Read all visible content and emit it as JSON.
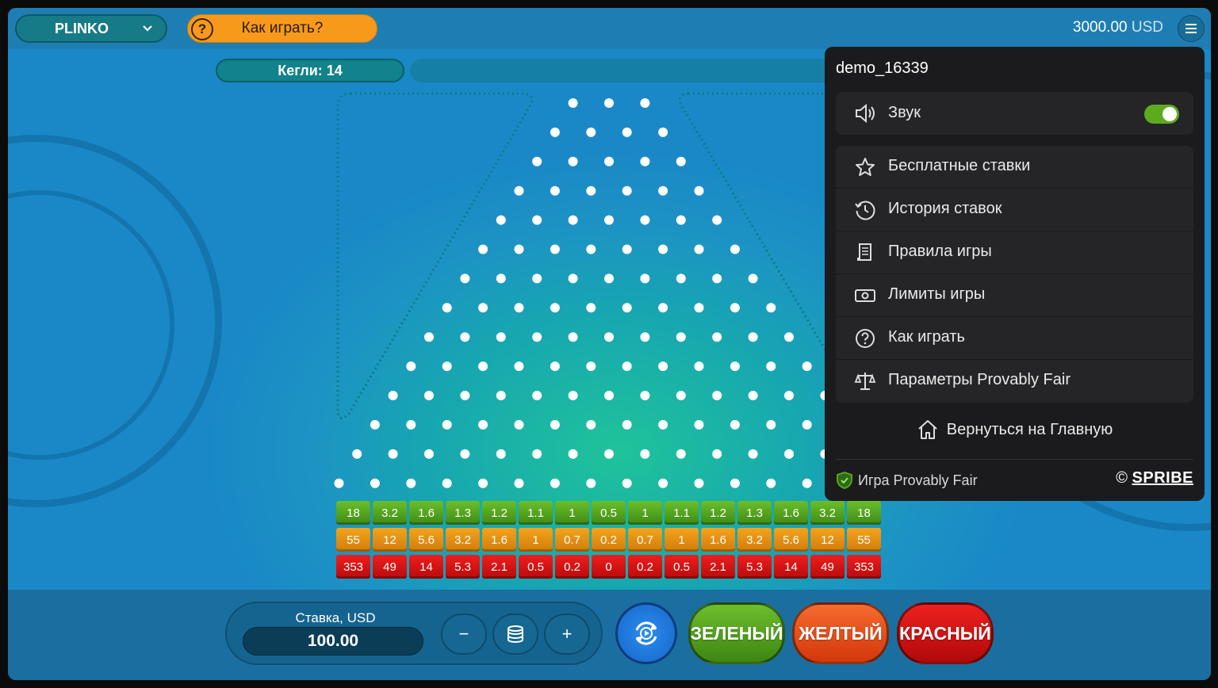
{
  "topbar": {
    "game": "PLINKO",
    "how_to_play": "Как играть?",
    "balance": "3000.00",
    "currency": "USD"
  },
  "board": {
    "pins_label": "Кегли: 14",
    "pin_rows": 14
  },
  "multipliers": {
    "green": [
      "18",
      "3.2",
      "1.6",
      "1.3",
      "1.2",
      "1.1",
      "1",
      "0.5",
      "1",
      "1.1",
      "1.2",
      "1.3",
      "1.6",
      "3.2",
      "18"
    ],
    "yellow": [
      "55",
      "12",
      "5.6",
      "3.2",
      "1.6",
      "1",
      "0.7",
      "0.2",
      "0.7",
      "1",
      "1.6",
      "3.2",
      "5.6",
      "12",
      "55"
    ],
    "red": [
      "353",
      "49",
      "14",
      "5.3",
      "2.1",
      "0.5",
      "0.2",
      "0",
      "0.2",
      "0.5",
      "2.1",
      "5.3",
      "14",
      "49",
      "353"
    ]
  },
  "bet": {
    "label": "Ставка, USD",
    "value": "100.00",
    "minus": "−",
    "plus": "+"
  },
  "buttons": {
    "green": "ЗЕЛЕНЫЙ",
    "yellow": "ЖЕЛТЫЙ",
    "red": "КРАСНЫЙ"
  },
  "menu": {
    "username": "demo_16339",
    "sound": "Звук",
    "sound_on": true,
    "items": [
      {
        "label": "Бесплатные ставки",
        "icon": "star-icon"
      },
      {
        "label": "История ставок",
        "icon": "history-icon"
      },
      {
        "label": "Правила игры",
        "icon": "rules-icon"
      },
      {
        "label": "Лимиты игры",
        "icon": "limits-icon"
      },
      {
        "label": "Как играть",
        "icon": "question-icon"
      },
      {
        "label": "Параметры Provably Fair",
        "icon": "scales-icon"
      }
    ],
    "home": "Вернуться на Главную",
    "provably_fair": "Игра Provably Fair",
    "brand": "SPRIBE",
    "copyright": "©"
  },
  "colors": {
    "green": "#4a9c1b",
    "yellow": "#f4a41c",
    "red": "#e31313",
    "accent_orange": "#f79a1c",
    "menu_bg": "#1b1b1d"
  }
}
